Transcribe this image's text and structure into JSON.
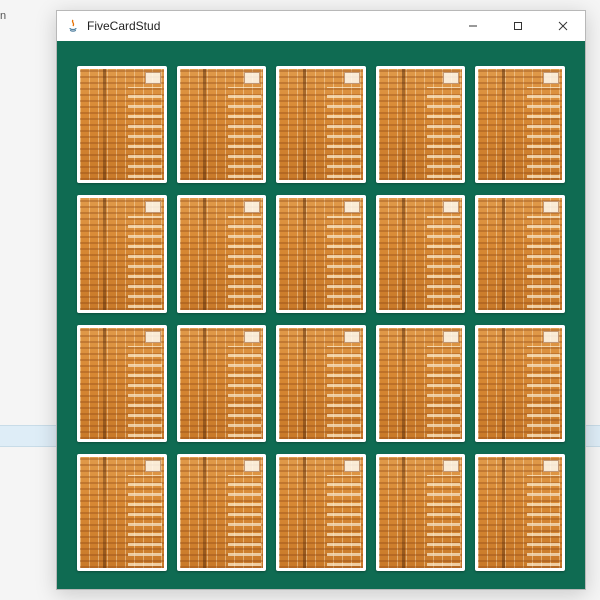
{
  "background": {
    "partial_text": "n"
  },
  "window": {
    "title": "FiveCardStud",
    "icon": "java-icon",
    "controls": {
      "minimize": "minimize-button",
      "maximize": "maximize-button",
      "close": "close-button"
    }
  },
  "board": {
    "background_color": "#0f6b52",
    "rows": 4,
    "cols": 5,
    "cards": [
      {
        "row": 0,
        "col": 0,
        "face": "back"
      },
      {
        "row": 0,
        "col": 1,
        "face": "back"
      },
      {
        "row": 0,
        "col": 2,
        "face": "back"
      },
      {
        "row": 0,
        "col": 3,
        "face": "back"
      },
      {
        "row": 0,
        "col": 4,
        "face": "back"
      },
      {
        "row": 1,
        "col": 0,
        "face": "back"
      },
      {
        "row": 1,
        "col": 1,
        "face": "back"
      },
      {
        "row": 1,
        "col": 2,
        "face": "back"
      },
      {
        "row": 1,
        "col": 3,
        "face": "back"
      },
      {
        "row": 1,
        "col": 4,
        "face": "back"
      },
      {
        "row": 2,
        "col": 0,
        "face": "back"
      },
      {
        "row": 2,
        "col": 1,
        "face": "back"
      },
      {
        "row": 2,
        "col": 2,
        "face": "back"
      },
      {
        "row": 2,
        "col": 3,
        "face": "back"
      },
      {
        "row": 2,
        "col": 4,
        "face": "back"
      },
      {
        "row": 3,
        "col": 0,
        "face": "back"
      },
      {
        "row": 3,
        "col": 1,
        "face": "back"
      },
      {
        "row": 3,
        "col": 2,
        "face": "back"
      },
      {
        "row": 3,
        "col": 3,
        "face": "back"
      },
      {
        "row": 3,
        "col": 4,
        "face": "back"
      }
    ]
  }
}
